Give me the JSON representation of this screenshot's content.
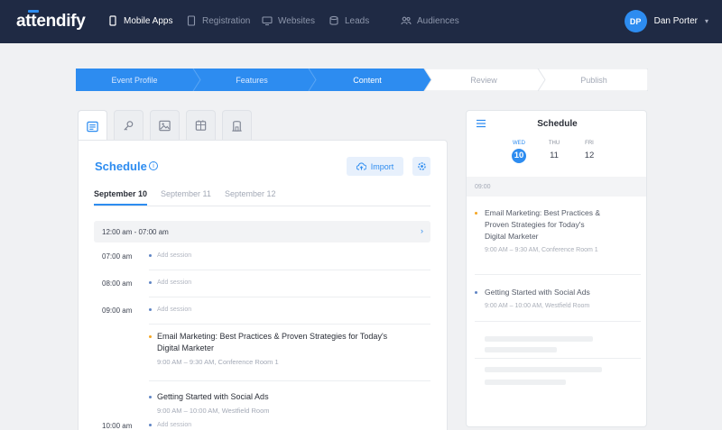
{
  "brand": {
    "logo": "attendify"
  },
  "nav": {
    "items": [
      {
        "label": "Mobile Apps",
        "icon": "phone-icon"
      },
      {
        "label": "Registration",
        "icon": "tablet-icon"
      },
      {
        "label": "Websites",
        "icon": "monitor-icon"
      },
      {
        "label": "Leads",
        "icon": "database-icon"
      },
      {
        "label": "Audiences",
        "icon": "users-icon"
      }
    ],
    "active": "Mobile Apps"
  },
  "user": {
    "initials": "DP",
    "name": "Dan Porter"
  },
  "stepper": {
    "steps": [
      "Event Profile",
      "Features",
      "Content",
      "Review",
      "Publish"
    ],
    "current": "Content"
  },
  "content_tabs": [
    "schedule-icon",
    "key-icon",
    "image-icon",
    "map-icon",
    "building-icon"
  ],
  "editor": {
    "title": "Schedule",
    "import_label": "Import",
    "days": [
      "September 10",
      "September 11",
      "September 12"
    ],
    "active_day": "September 10",
    "range_label": "12:00 am - 07:00 am",
    "add_session_label": "Add session",
    "times": [
      "07:00 am",
      "08:00 am",
      "09:00 am",
      "10:00 am"
    ],
    "sessions": [
      {
        "title_line1": "Email Marketing: Best Practices & Proven Strategies for Today's",
        "title_line2": "Digital Marketer",
        "meta": "9:00 AM  –  9:30 AM,  Conference Room 1"
      },
      {
        "title_line1": "Getting Started with Social Ads",
        "meta": "9:00 AM  –  10:00 AM,  Westfield Room"
      }
    ]
  },
  "preview": {
    "title": "Schedule",
    "days": [
      {
        "name": "WED",
        "num": "10"
      },
      {
        "name": "THU",
        "num": "11"
      },
      {
        "name": "FRI",
        "num": "12"
      }
    ],
    "selected_day": "10",
    "band_time": "09:00",
    "sessions": [
      {
        "line1": "Email Marketing: Best Practices &",
        "line2": "Proven Strategies for Today's",
        "line3": "Digital Marketer",
        "meta": "9:00 AM  –  9:30 AM,  Conference Room 1"
      },
      {
        "line1": "Getting Started with Social Ads",
        "meta": "9:00 AM  –  10:00 AM,  Westfield Room"
      }
    ]
  },
  "colors": {
    "nav_bg": "#1f2a44",
    "accent": "#2d8cf0",
    "page_bg": "#f0f1f3",
    "session_dot": "#f5a623"
  }
}
